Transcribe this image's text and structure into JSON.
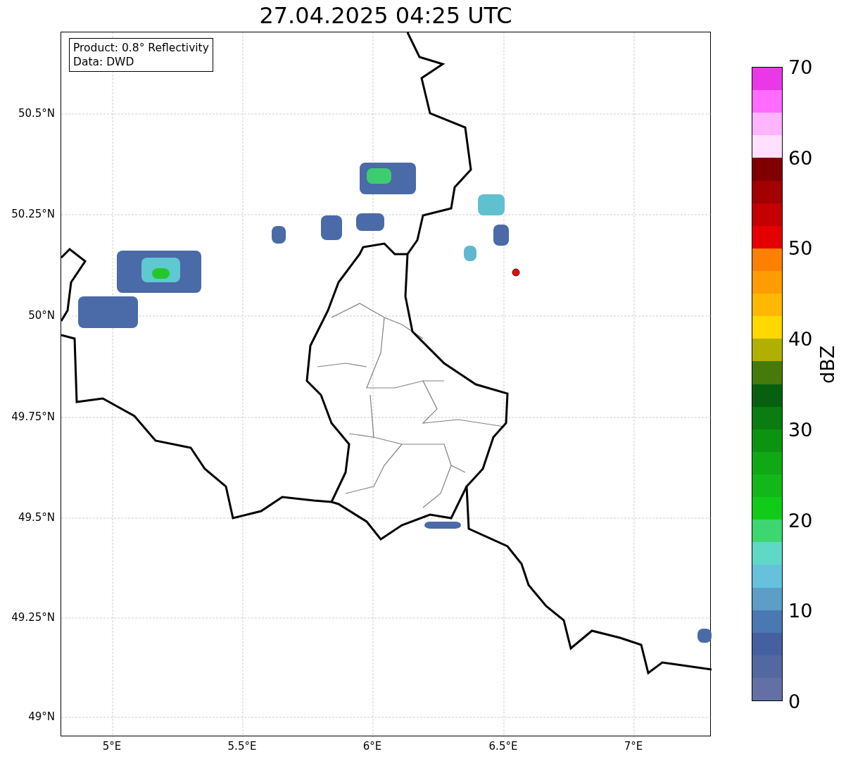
{
  "title": "27.04.2025 04:25 UTC",
  "info_box": {
    "lines": [
      "Product: 0.8° Reflectivity",
      "Data: DWD"
    ]
  },
  "map": {
    "yticks": [
      "50.5°N",
      "50.25°N",
      "50°N",
      "49.75°N",
      "49.5°N",
      "49.25°N",
      "49°N"
    ],
    "xticks": [
      "5°E",
      "5.5°E",
      "6°E",
      "6.5°E",
      "7°E"
    ]
  },
  "colorbar": {
    "label": "dBZ",
    "ticks": [
      "70",
      "60",
      "50",
      "40",
      "30",
      "20",
      "10",
      "0"
    ],
    "segments": [
      {
        "color": "#e838e8"
      },
      {
        "color": "#ff6cff"
      },
      {
        "color": "#ffb4ff"
      },
      {
        "color": "#ffe0ff"
      },
      {
        "color": "#800000"
      },
      {
        "color": "#a40000"
      },
      {
        "color": "#c40000"
      },
      {
        "color": "#e40000"
      },
      {
        "color": "#ff8000"
      },
      {
        "color": "#ff9c00"
      },
      {
        "color": "#ffb800"
      },
      {
        "color": "#ffd800"
      },
      {
        "color": "#b0b000"
      },
      {
        "color": "#467a0a"
      },
      {
        "color": "#066010"
      },
      {
        "color": "#0a7c10"
      },
      {
        "color": "#0c9410"
      },
      {
        "color": "#10a814"
      },
      {
        "color": "#12b818"
      },
      {
        "color": "#10cc18"
      },
      {
        "color": "#3ed670"
      },
      {
        "color": "#60d8c8"
      },
      {
        "color": "#66c2dc"
      },
      {
        "color": "#5c9ec6"
      },
      {
        "color": "#4a78b0"
      },
      {
        "color": "#4460a0"
      },
      {
        "color": "#5468a0"
      },
      {
        "color": "#6270a6"
      }
    ]
  }
}
